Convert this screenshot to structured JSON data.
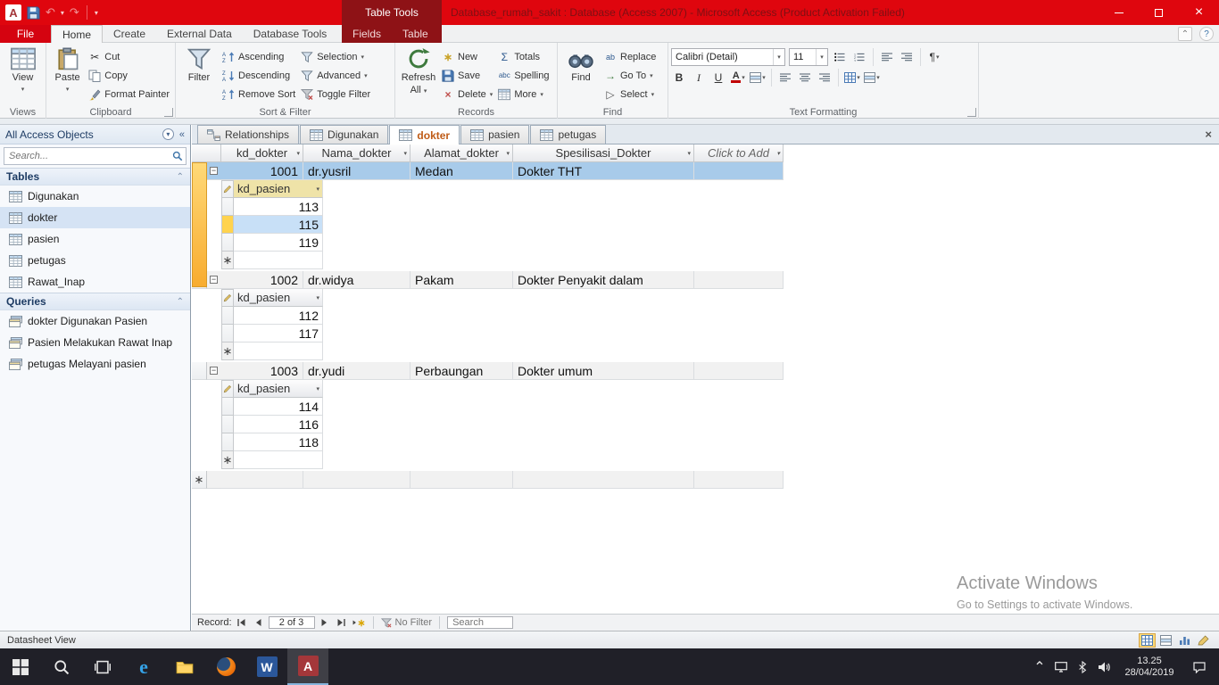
{
  "titlebar": {
    "table_tools": "Table Tools",
    "title": "Database_rumah_sakit : Database (Access 2007)  -  Microsoft Access (Product Activation Failed)"
  },
  "tabs": {
    "file": "File",
    "home": "Home",
    "create": "Create",
    "external_data": "External Data",
    "database_tools": "Database Tools",
    "fields": "Fields",
    "table": "Table"
  },
  "ribbon": {
    "views": {
      "caption": "Views",
      "view": "View"
    },
    "clipboard": {
      "caption": "Clipboard",
      "paste": "Paste",
      "cut": "Cut",
      "copy": "Copy",
      "format_painter": "Format Painter"
    },
    "sort_filter": {
      "caption": "Sort & Filter",
      "filter": "Filter",
      "ascending": "Ascending",
      "descending": "Descending",
      "remove_sort": "Remove Sort",
      "selection": "Selection",
      "advanced": "Advanced",
      "toggle_filter": "Toggle Filter"
    },
    "records": {
      "caption": "Records",
      "refresh_line1": "Refresh",
      "refresh_line2": "All",
      "new": "New",
      "save": "Save",
      "delete": "Delete",
      "totals": "Totals",
      "spelling": "Spelling",
      "more": "More"
    },
    "find": {
      "caption": "Find",
      "find": "Find",
      "replace": "Replace",
      "go_to": "Go To",
      "select": "Select"
    },
    "text_formatting": {
      "caption": "Text Formatting",
      "font": "Calibri (Detail)",
      "size": "11",
      "bold": "B",
      "italic": "I",
      "underline": "U"
    }
  },
  "nav_pane": {
    "header": "All Access Objects",
    "search_placeholder": "Search...",
    "tables_header": "Tables",
    "tables": [
      "Digunakan",
      "dokter",
      "pasien",
      "petugas",
      "Rawat_Inap"
    ],
    "queries_header": "Queries",
    "queries": [
      "dokter Digunakan Pasien",
      "Pasien Melakukan Rawat Inap",
      "petugas Melayani pasien"
    ]
  },
  "doc_tabs": [
    "Relationships",
    "Digunakan",
    "dokter",
    "pasien",
    "petugas"
  ],
  "datasheet": {
    "columns": [
      "kd_dokter",
      "Nama_dokter",
      "Alamat_dokter",
      "Spesilisasi_Dokter",
      "Click to Add"
    ],
    "sub_column": "kd_pasien",
    "records": [
      {
        "kd_dokter": "1001",
        "nama_dokter": "dr.yusril",
        "alamat_dokter": "Medan",
        "spesilisasi_dokter": "Dokter THT",
        "kd_pasien": [
          "113",
          "115",
          "119"
        ]
      },
      {
        "kd_dokter": "1002",
        "nama_dokter": "dr.widya",
        "alamat_dokter": "Pakam",
        "spesilisasi_dokter": "Dokter Penyakit dalam",
        "kd_pasien": [
          "112",
          "117"
        ]
      },
      {
        "kd_dokter": "1003",
        "nama_dokter": "dr.yudi",
        "alamat_dokter": "Perbaungan",
        "spesilisasi_dokter": "Dokter umum",
        "kd_pasien": [
          "114",
          "116",
          "118"
        ]
      }
    ]
  },
  "record_nav": {
    "label": "Record:",
    "position": "2 of 3",
    "no_filter": "No Filter",
    "search_placeholder": "Search"
  },
  "status_bar": {
    "view_name": "Datasheet View"
  },
  "taskbar": {
    "time": "13.25",
    "date": "28/04/2019"
  },
  "watermark": {
    "line1": "Activate Windows",
    "line2": "Go to Settings to activate Windows."
  }
}
